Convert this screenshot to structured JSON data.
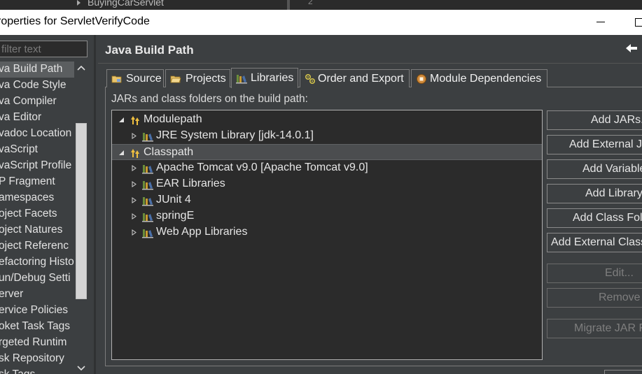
{
  "background_window": {
    "tree_item": "BuyingCarServlet",
    "line_number": "2"
  },
  "window": {
    "title": "roperties for ServletVerifyCode"
  },
  "filter": {
    "placeholder": "filter text"
  },
  "nav": {
    "items": [
      {
        "label": "va Build Path",
        "selected": true
      },
      {
        "label": "va Code Style"
      },
      {
        "label": "va Compiler"
      },
      {
        "label": "va Editor"
      },
      {
        "label": "vadoc Location"
      },
      {
        "label": "vaScript"
      },
      {
        "label": "vaScript Profile"
      },
      {
        "label": "P Fragment"
      },
      {
        "label": "amespaces"
      },
      {
        "label": "oject Facets"
      },
      {
        "label": "oject Natures"
      },
      {
        "label": "oject Referenc"
      },
      {
        "label": "efactoring Histo"
      },
      {
        "label": "un/Debug Setti"
      },
      {
        "label": "erver"
      },
      {
        "label": "ervice Policies"
      },
      {
        "label": "oket Task Tags"
      },
      {
        "label": "rgeted Runtim"
      },
      {
        "label": "sk Repository"
      },
      {
        "label": "sk Tags"
      }
    ]
  },
  "page": {
    "title": "Java Build Path"
  },
  "tabs": [
    {
      "label": "Source",
      "icon": "source-folder-icon"
    },
    {
      "label": "Projects",
      "icon": "projects-icon"
    },
    {
      "label": "Libraries",
      "icon": "library-icon",
      "active": true
    },
    {
      "label": "Order and Export",
      "icon": "order-export-icon"
    },
    {
      "label": "Module Dependencies",
      "icon": "module-icon"
    }
  ],
  "libraries": {
    "caption": "JARs and class folders on the build path:",
    "tree": [
      {
        "label": "Modulepath",
        "level": 0,
        "expanded": true,
        "icon": "path-container-icon"
      },
      {
        "label": "JRE System Library [jdk-14.0.1]",
        "level": 1,
        "icon": "library-icon"
      },
      {
        "label": "Classpath",
        "level": 0,
        "expanded": true,
        "selected": true,
        "icon": "path-container-icon"
      },
      {
        "label": "Apache Tomcat v9.0 [Apache Tomcat v9.0]",
        "level": 1,
        "icon": "library-icon"
      },
      {
        "label": "EAR Libraries",
        "level": 1,
        "icon": "library-icon"
      },
      {
        "label": "JUnit 4",
        "level": 1,
        "icon": "library-icon"
      },
      {
        "label": "springE",
        "level": 1,
        "icon": "library-icon"
      },
      {
        "label": "Web App Libraries",
        "level": 1,
        "icon": "library-icon"
      }
    ]
  },
  "buttons": {
    "add_jars": "Add JARs...",
    "add_external_jars": "Add External JARs...",
    "add_variable": "Add Variable...",
    "add_library": "Add Library...",
    "add_class_folder": "Add Class Folder...",
    "add_external_class_folder": "Add External Class Folder...",
    "edit": "Edit...",
    "remove": "Remove",
    "migrate_jar": "Migrate JAR File..."
  },
  "colors": {
    "background": "#3c3f41",
    "tree_background": "#2b2b2b",
    "selection": "#4b4d4f"
  }
}
